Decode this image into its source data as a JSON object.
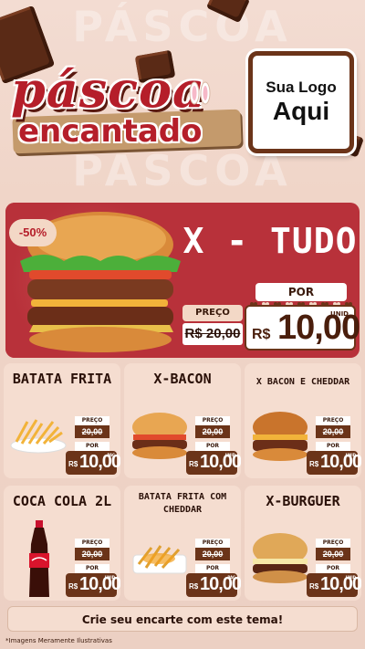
{
  "background_text": "PÁSCOA",
  "header": {
    "title_main": "páscoa",
    "title_sub": "encantado",
    "logo_line1": "Sua Logo",
    "logo_line2": "Aqui"
  },
  "hero": {
    "discount": "-50%",
    "title": "X - TUDO",
    "preco_label": "PREÇO",
    "old_price": "R$ 20,00",
    "por_label": "POR",
    "currency": "R$",
    "new_price": "10,00",
    "unit": "UNID"
  },
  "cards": [
    {
      "title": "BATATA FRITA",
      "size": "big",
      "preco_label": "PREÇO",
      "old_price": "20,00",
      "por_label": "POR",
      "currency": "R$",
      "price": "10,00",
      "unit": "PAC",
      "image": "fries"
    },
    {
      "title": "X-BACON",
      "size": "big",
      "preco_label": "PREÇO",
      "old_price": "20,00",
      "por_label": "POR",
      "currency": "R$",
      "price": "10,00",
      "unit": "UNID",
      "image": "burger"
    },
    {
      "title": "X BACON E CHEDDAR",
      "size": "small",
      "preco_label": "PREÇO",
      "old_price": "20,00",
      "por_label": "POR",
      "currency": "R$",
      "price": "10,00",
      "unit": "UNID",
      "image": "burger-cheddar"
    },
    {
      "title": "COCA COLA 2L",
      "size": "big",
      "preco_label": "PREÇO",
      "old_price": "20,00",
      "por_label": "POR",
      "currency": "R$",
      "price": "10,00",
      "unit": "UNID",
      "image": "soda"
    },
    {
      "title": "BATATA FRITA COM CHEDDAR",
      "size": "small",
      "preco_label": "PREÇO",
      "old_price": "20,00",
      "por_label": "POR",
      "currency": "R$",
      "price": "10,00",
      "unit": "PAC",
      "image": "fries-cheddar"
    },
    {
      "title": "X-BURGUER",
      "size": "big",
      "preco_label": "PREÇO",
      "old_price": "20,00",
      "por_label": "POR",
      "currency": "R$",
      "price": "10,00",
      "unit": "UNID",
      "image": "burger-plain"
    }
  ],
  "cta": "Crie seu encarte com este tema!",
  "disclaimer": "*Imagens Meramente Ilustrativas",
  "colors": {
    "brand_red": "#b51e2a",
    "chocolate": "#6b3419",
    "card_bg": "#f5ddd0"
  }
}
